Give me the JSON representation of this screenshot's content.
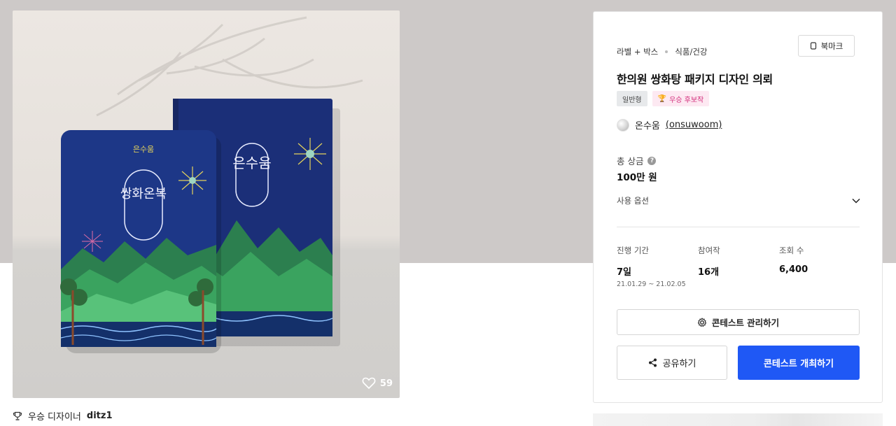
{
  "hero": {
    "like_count": "59",
    "package_logo": "은수움",
    "package_name": "쌍화온복"
  },
  "winner": {
    "prefix": "우승 디자이너",
    "name": "ditz1"
  },
  "card": {
    "breadcrumb": [
      "라벨 + 박스",
      "식품/건강"
    ],
    "bookmark_label": "북마크",
    "title": "한의원 쌍화탕 패키지 디자인 의뢰",
    "tags": [
      {
        "label": "일반형",
        "style": "gray"
      },
      {
        "label": "우승 후보작",
        "style": "pink",
        "icon": "trophy-icon"
      }
    ],
    "author": {
      "name": "온수움",
      "handle": "(onsuwoom)"
    },
    "prize": {
      "label": "총 상금",
      "value": "100만 원"
    },
    "options_label": "사용 옵션",
    "stats": [
      {
        "label": "진행 기간",
        "value": "7일",
        "sub": "21.01.29 ~ 21.02.05"
      },
      {
        "label": "참여작",
        "value": "16개",
        "sub": ""
      },
      {
        "label": "조회 수",
        "value": "6,400",
        "sub": ""
      }
    ],
    "manage_label": "콘테스트 관리하기",
    "share_label": "공유하기",
    "host_label": "콘테스트 개최하기"
  },
  "colors": {
    "accent": "#1f58f5",
    "tag_pink_text": "#d22d7b",
    "tag_pink_bg": "#fde9f2",
    "package_navy": "#1b2f78"
  }
}
